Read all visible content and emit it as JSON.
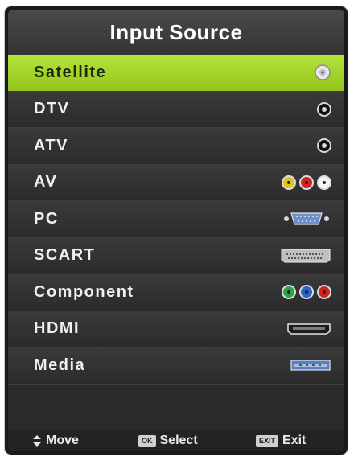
{
  "menu": {
    "title": "Input Source",
    "selected_index": 0,
    "items": [
      {
        "label": "Satellite",
        "icon": "satellite-jack-icon"
      },
      {
        "label": "DTV",
        "icon": "antenna-jack-icon"
      },
      {
        "label": "ATV",
        "icon": "antenna-jack-icon"
      },
      {
        "label": "AV",
        "icon": "rca-yellow-red-white-icon"
      },
      {
        "label": "PC",
        "icon": "vga-port-icon"
      },
      {
        "label": "SCART",
        "icon": "scart-port-icon"
      },
      {
        "label": "Component",
        "icon": "rca-green-blue-red-icon"
      },
      {
        "label": "HDMI",
        "icon": "hdmi-port-icon"
      },
      {
        "label": "Media",
        "icon": "usb-port-icon"
      }
    ]
  },
  "footer": {
    "move_label": "Move",
    "select_key": "OK",
    "select_label": "Select",
    "exit_key": "EXIT",
    "exit_label": "Exit"
  },
  "colors": {
    "selected": "#a4d62c",
    "background": "#2a2a2a",
    "header": "#3d3d3d"
  }
}
